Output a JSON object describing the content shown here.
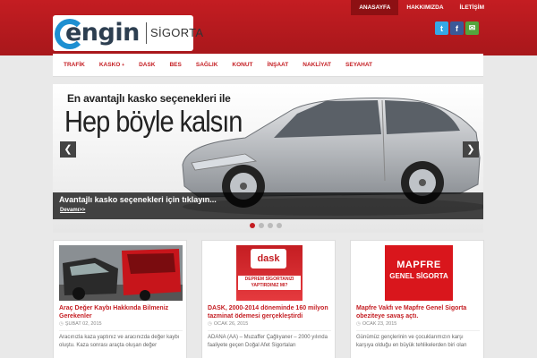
{
  "top_nav": [
    "ANASAYFA",
    "HAKKIMIZDA",
    "İLETİŞİM"
  ],
  "logo": {
    "brand": "engin",
    "suffix": "SİGORTA"
  },
  "social": {
    "twitter": "t",
    "facebook": "f",
    "mail": "✉"
  },
  "main_nav": [
    "TRAFİK",
    "KASKO",
    "DASK",
    "BES",
    "SAĞLIK",
    "KONUT",
    "İNŞAAT",
    "NAKLİYAT",
    "SEYAHAT"
  ],
  "slider": {
    "headline_small": "En avantajlı kasko seçenekleri ile",
    "headline_big": "Hep böyle kalsın",
    "caption_title": "Avantajlı kasko seçenekleri için tıklayın...",
    "caption_link": "Devamı>>",
    "prev": "❮",
    "next": "❯",
    "dots": 4
  },
  "cards": [
    {
      "title": "Araç Değer Kaybı Hakkında Bilmeniz Gerekenler",
      "date": "ŞUBAT 02, 2015",
      "excerpt": "Aracınızla kaza yaptınız ve aracınızda değer kaybı oluştu. Kaza sonrası araçta oluşan değer"
    },
    {
      "title": "DASK, 2000-2014 döneminde 160 milyon tazminat ödemesi gerçekleştirdi",
      "date": "OCAK 26, 2015",
      "excerpt": "ADANA (AA) – Muzaffer Çağlıyaner – 2000 yılında faaliyete geçen Doğal Afet Sigortaları",
      "thumb_text": "DEPREM SİGORTANIZI YAPTIRDINIZ MI?",
      "thumb_logo": "dask"
    },
    {
      "title": "Mapfre Vakfı ve Mapfre Genel Sigorta obeziteye savaş açtı.",
      "date": "OCAK 23, 2015",
      "excerpt": "Günümüz gençlerinin ve çocuklarımızın karşı karşıya olduğu en büyük tehlikelerden biri olan",
      "thumb_line1": "MAPFRE",
      "thumb_line2": "GENEL SİGORTA"
    }
  ]
}
